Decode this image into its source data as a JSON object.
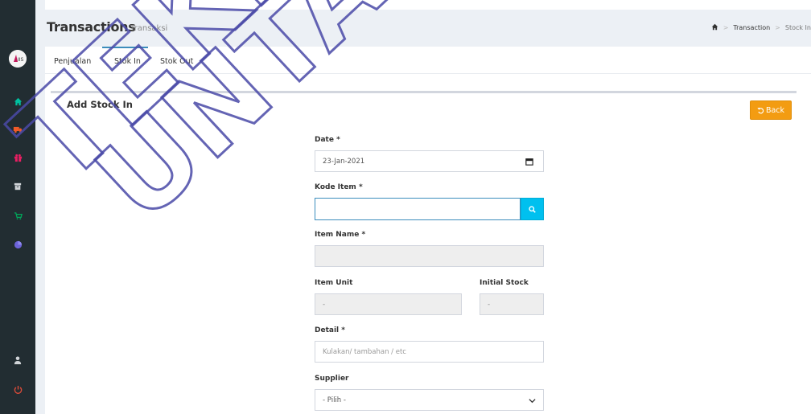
{
  "header": {
    "title": "Transactions",
    "subtitle": "Transaksi",
    "breadcrumb": {
      "home_icon": "home-icon",
      "items": [
        "Transaction",
        "Stock In"
      ]
    }
  },
  "sidebar": {
    "logo_text": "IIS",
    "icons": [
      "home-icon",
      "truck-icon",
      "gift-icon",
      "archive-icon",
      "cart-icon",
      "pie-chart-icon",
      "user-icon",
      "power-icon"
    ]
  },
  "tabs": [
    {
      "label": "Penjualan",
      "active": false
    },
    {
      "label": "Stok In",
      "active": true
    },
    {
      "label": "Stok Out",
      "active": false
    }
  ],
  "card": {
    "title": "Add Stock In",
    "back_label": "Back"
  },
  "form": {
    "date_label": "Date *",
    "date_value": "23-Jan-2021",
    "kode_item_label": "Kode Item *",
    "kode_item_value": "",
    "item_name_label": "Item Name *",
    "item_name_value": "",
    "item_unit_label": "Item Unit",
    "item_unit_value": "-",
    "initial_stock_label": "Initial Stock",
    "initial_stock_value": "-",
    "detail_label": "Detail *",
    "detail_placeholder": "Kulakan/ tambahan / etc",
    "supplier_label": "Supplier",
    "supplier_selected": "- Pilih -"
  },
  "watermark_text": [
    "TEKNIK",
    "UNTAG"
  ],
  "colors": {
    "sidebar_bg": "#222d32",
    "accent_blue": "#3c8dbc",
    "search_button": "#00c0ef",
    "back_button": "#f39c12",
    "watermark": "#4a4aa8"
  }
}
